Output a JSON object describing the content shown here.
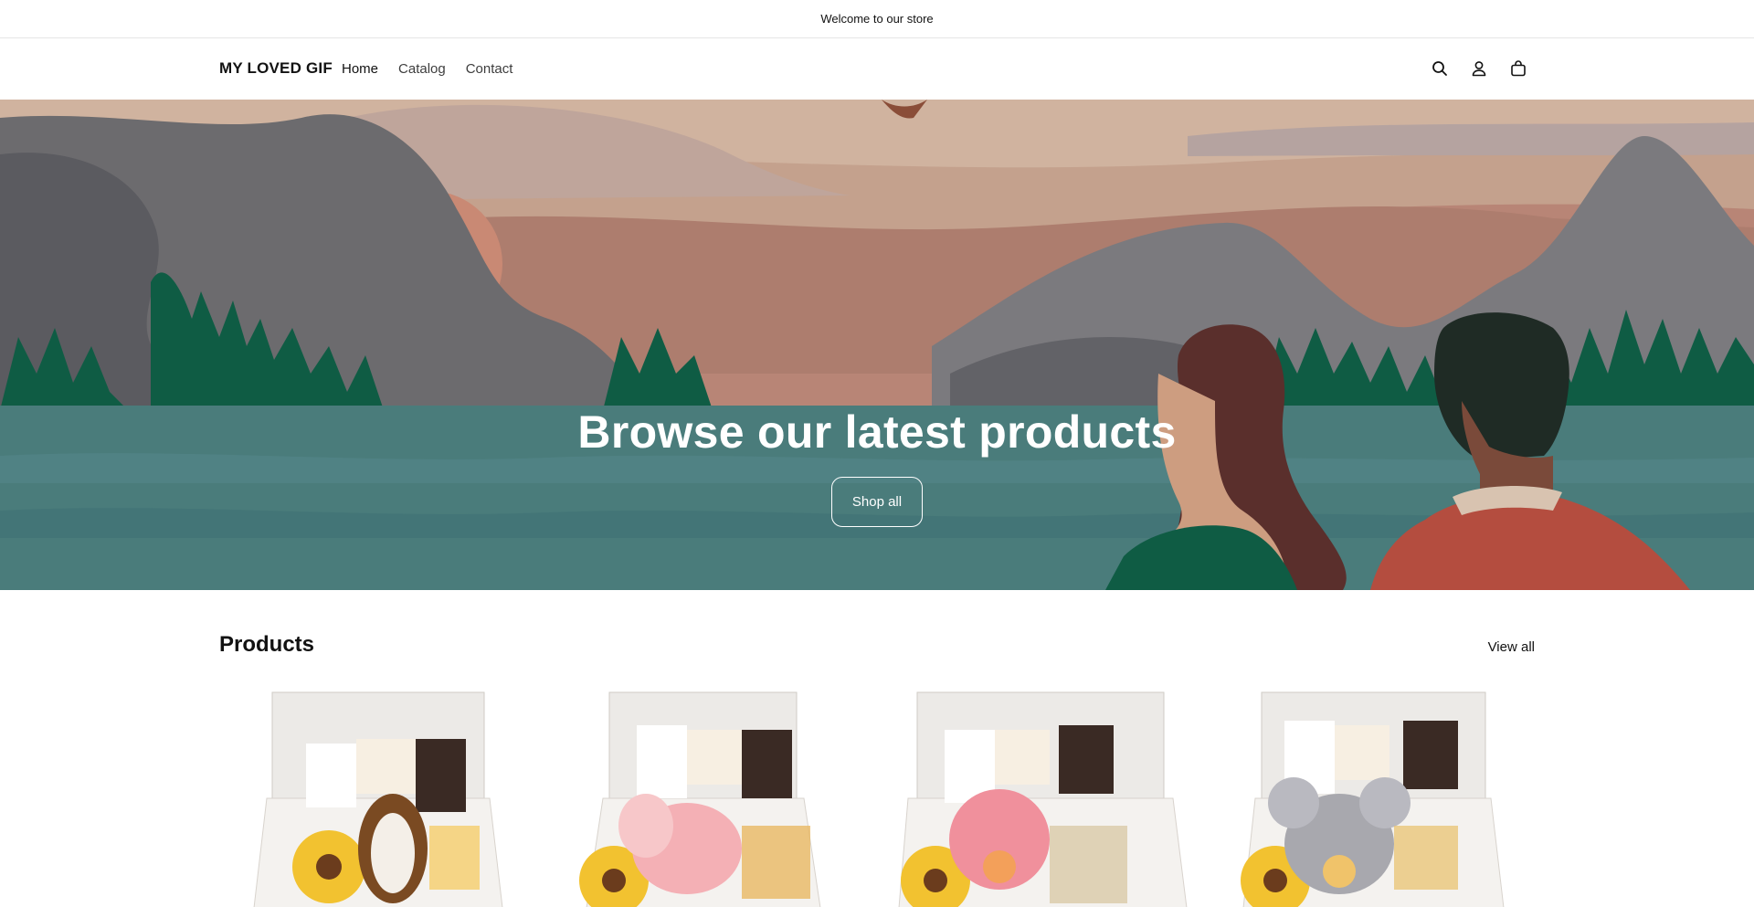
{
  "announcement": {
    "text": "Welcome to our store"
  },
  "header": {
    "logo": "MY LOVED GIF",
    "nav": [
      {
        "label": "Home",
        "active": true
      },
      {
        "label": "Catalog",
        "active": false
      },
      {
        "label": "Contact",
        "active": false
      }
    ],
    "icons": [
      "search-icon",
      "account-icon",
      "cart-icon"
    ]
  },
  "hero": {
    "title": "Browse our latest products",
    "button_label": "Shop all"
  },
  "products": {
    "title": "Products",
    "view_all_label": "View all",
    "items": [
      {
        "plush": "sunflower-bunny",
        "plush_color": "#f2c230"
      },
      {
        "plush": "pink-elephant",
        "plush_color": "#f4b0b5"
      },
      {
        "plush": "pink-koala",
        "plush_color": "#f0909c"
      },
      {
        "plush": "gray-koala",
        "plush_color": "#a8a8ae"
      }
    ]
  },
  "colors": {
    "hero_sky": "#c2a08c",
    "hero_water": "#4a7c7b",
    "hero_trees": "#0f5c44",
    "text_primary": "#121212"
  }
}
